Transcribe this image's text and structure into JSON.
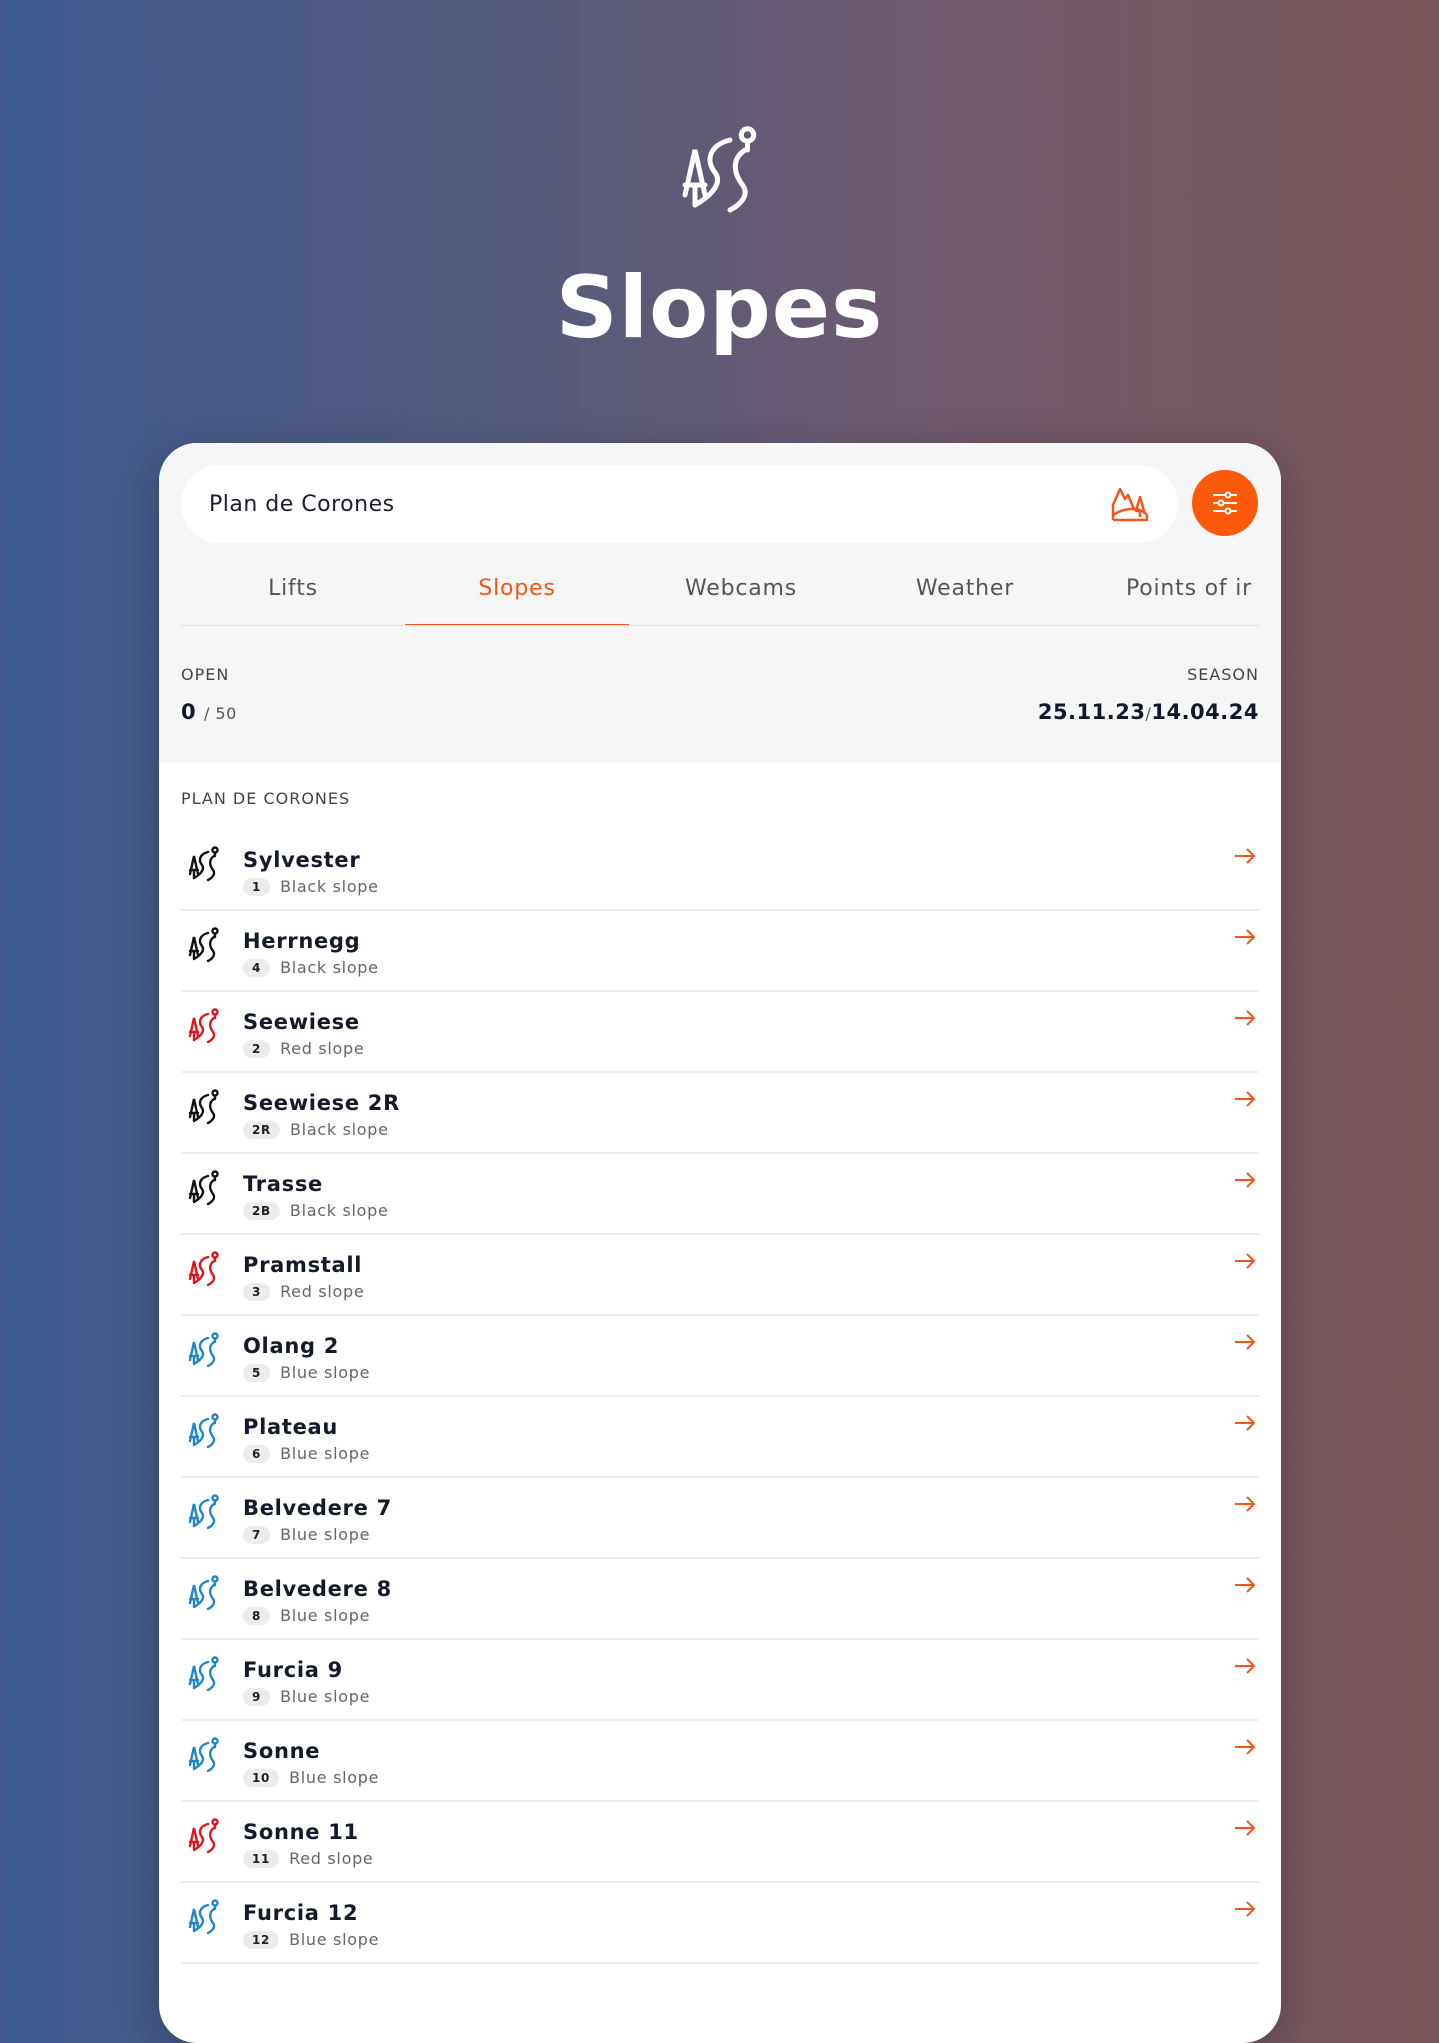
{
  "page": {
    "title": "Slopes",
    "logo": "slope-icon"
  },
  "search": {
    "value": "Plan de Corones",
    "icon": "mountain-icon",
    "filter_icon": "sliders-icon"
  },
  "tabs": [
    {
      "label": "Lifts"
    },
    {
      "label": "Slopes",
      "active": true
    },
    {
      "label": "Webcams"
    },
    {
      "label": "Weather"
    },
    {
      "label": "Points of ir"
    }
  ],
  "stats": {
    "open_label": "OPEN",
    "open_value": "0",
    "open_total": "/ 50",
    "season_label": "SEASON",
    "season_start": "25.11.23",
    "season_sep": "/",
    "season_end": "14.04.24"
  },
  "section": "PLAN DE CORONES",
  "colors": {
    "accent": "#fc5a0a",
    "black": "#111111",
    "red": "#e0141e",
    "blue": "#1f86c8"
  },
  "slopes": [
    {
      "name": "Sylvester",
      "number": "1",
      "type": "Black slope",
      "color": "black"
    },
    {
      "name": "Herrnegg",
      "number": "4",
      "type": "Black slope",
      "color": "black"
    },
    {
      "name": "Seewiese",
      "number": "2",
      "type": "Red slope",
      "color": "red"
    },
    {
      "name": "Seewiese 2R",
      "number": "2R",
      "type": "Black slope",
      "color": "black"
    },
    {
      "name": "Trasse",
      "number": "2B",
      "type": "Black slope",
      "color": "black"
    },
    {
      "name": "Pramstall",
      "number": "3",
      "type": "Red slope",
      "color": "red"
    },
    {
      "name": "Olang 2",
      "number": "5",
      "type": "Blue slope",
      "color": "blue"
    },
    {
      "name": "Plateau",
      "number": "6",
      "type": "Blue slope",
      "color": "blue"
    },
    {
      "name": "Belvedere 7",
      "number": "7",
      "type": "Blue slope",
      "color": "blue"
    },
    {
      "name": "Belvedere 8",
      "number": "8",
      "type": "Blue slope",
      "color": "blue"
    },
    {
      "name": "Furcia 9",
      "number": "9",
      "type": "Blue slope",
      "color": "blue"
    },
    {
      "name": "Sonne",
      "number": "10",
      "type": "Blue slope",
      "color": "blue"
    },
    {
      "name": "Sonne 11",
      "number": "11",
      "type": "Red slope",
      "color": "red"
    },
    {
      "name": "Furcia 12",
      "number": "12",
      "type": "Blue slope",
      "color": "blue"
    }
  ]
}
